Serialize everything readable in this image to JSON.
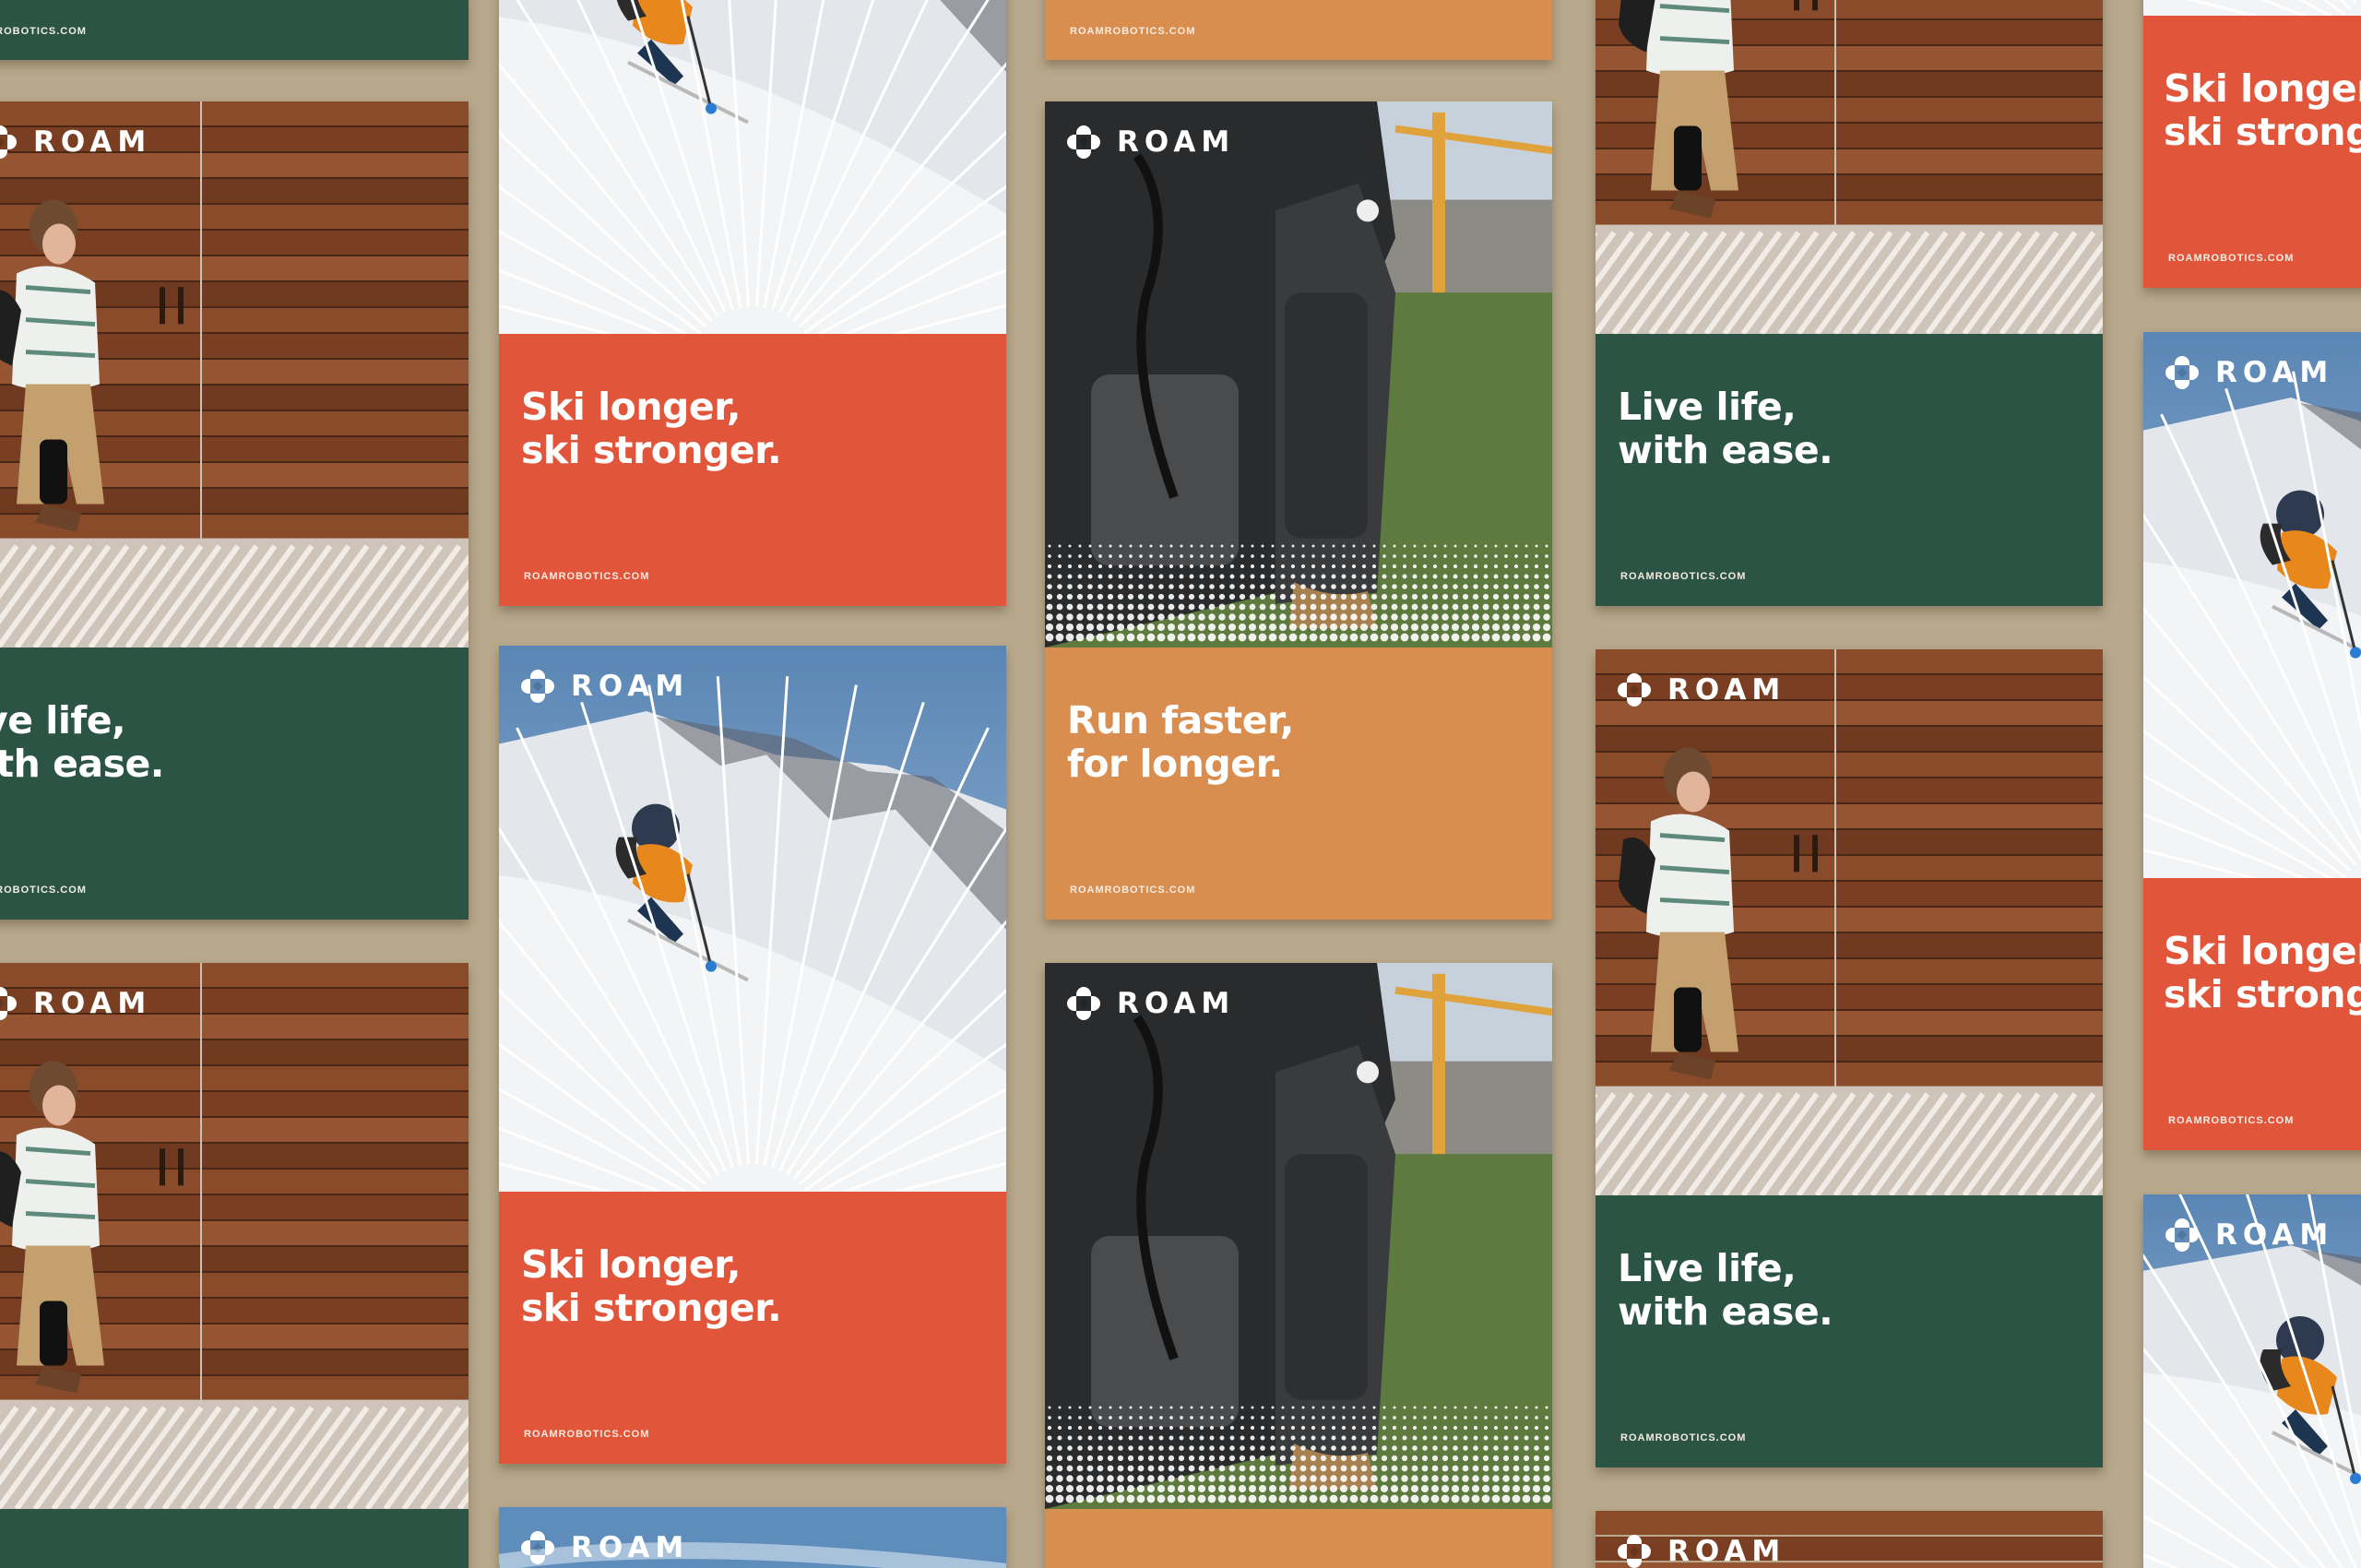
{
  "brand": {
    "logo_text": "ROAM",
    "url": "ROAMROBOTICS.COM"
  },
  "headlines": {
    "ski": [
      "Ski longer,",
      "ski stronger."
    ],
    "live": [
      "Live life,",
      "with ease."
    ],
    "run": [
      "Run faster,",
      "for longer."
    ],
    "live_cropped": [
      "ve life,",
      "ith ease."
    ],
    "ski_cropped": [
      "Ski longer,",
      "ski stronge"
    ]
  },
  "url_cropped": "MROBOTICS.COM",
  "colors": {
    "background": "#b8a88c",
    "ski_panel": "#e1563a",
    "live_panel": "#2c5445",
    "run_panel": "#d98e4f"
  },
  "photo_subjects": {
    "ski": "skier on snowy mountain slope",
    "live": "woman walking with knee exoskeleton by wooden wall",
    "run": "legs wearing robotic knee exoskeleton on field"
  },
  "icons": [
    "roam-logo-icon"
  ]
}
